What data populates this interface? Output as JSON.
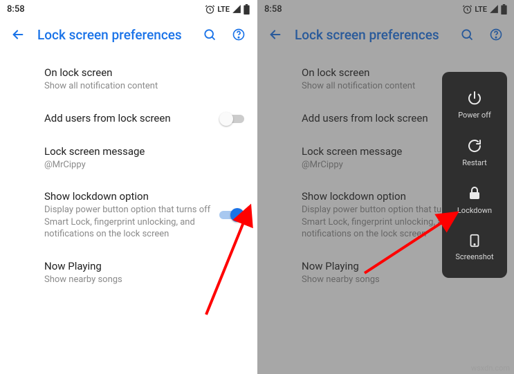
{
  "status": {
    "time": "8:58",
    "network_label": "LTE"
  },
  "appbar": {
    "title": "Lock screen preferences"
  },
  "rows": {
    "onlock": {
      "title": "On lock screen",
      "sub": "Show all notification content"
    },
    "addusers": {
      "title": "Add users from lock screen"
    },
    "message": {
      "title": "Lock screen message",
      "sub": "@MrCippy"
    },
    "lockdown": {
      "title": "Show lockdown option",
      "sub": "Display power button option that turns off Smart Lock, fingerprint unlocking, and notifications on the lock screen"
    },
    "nowplay": {
      "title": "Now Playing",
      "sub": "Show nearby songs"
    }
  },
  "powermenu": {
    "poweroff": "Power off",
    "restart": "Restart",
    "lockdown": "Lockdown",
    "screenshot": "Screenshot"
  },
  "watermark": "wsxdn.com",
  "colors": {
    "accent": "#1a73e8",
    "arrow": "#ff0000"
  }
}
